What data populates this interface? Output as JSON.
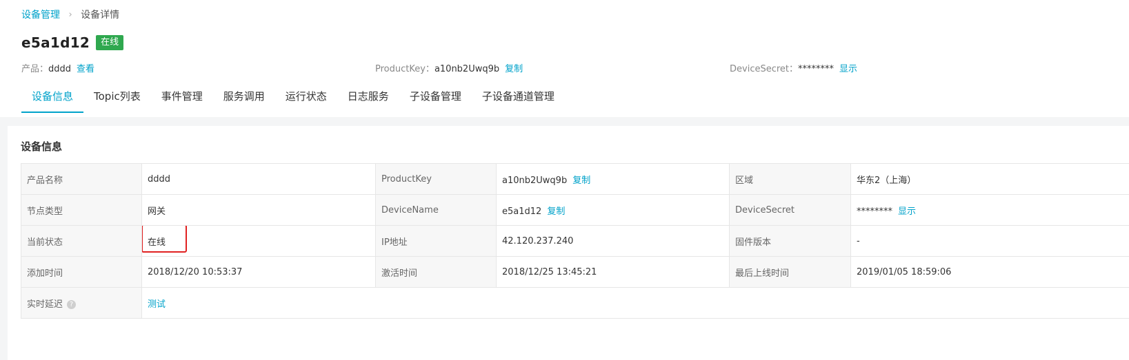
{
  "breadcrumb": {
    "parent": "设备管理",
    "separator": "›",
    "current": "设备详情"
  },
  "device": {
    "name": "e5a1d12",
    "status_badge": "在线"
  },
  "meta": {
    "product_label": "产品：",
    "product_value": "dddd",
    "product_action": "查看",
    "productkey_label": "ProductKey：",
    "productkey_value": "a10nb2Uwq9b",
    "productkey_action": "复制",
    "secret_label": "DeviceSecret：",
    "secret_value": "********",
    "secret_action": "显示"
  },
  "tabs": [
    "设备信息",
    "Topic列表",
    "事件管理",
    "服务调用",
    "运行状态",
    "日志服务",
    "子设备管理",
    "子设备通道管理"
  ],
  "panel": {
    "title": "设备信息",
    "rows": [
      {
        "k1": "产品名称",
        "v1": "dddd",
        "k2": "ProductKey",
        "v2": "a10nb2Uwq9b",
        "v2_action": "复制",
        "k3": "区域",
        "v3": "华东2（上海）"
      },
      {
        "k1": "节点类型",
        "v1": "网关",
        "k2": "DeviceName",
        "v2": "e5a1d12",
        "v2_action": "复制",
        "k3": "DeviceSecret",
        "v3": "********",
        "v3_action": "显示"
      },
      {
        "k1": "当前状态",
        "v1": "在线",
        "k2": "IP地址",
        "v2": "42.120.237.240",
        "k3": "固件版本",
        "v3": "-"
      },
      {
        "k1": "添加时间",
        "v1": "2018/12/20 10:53:37",
        "k2": "激活时间",
        "v2": "2018/12/25 13:45:21",
        "k3": "最后上线时间",
        "v3": "2019/01/05 18:59:06"
      },
      {
        "k1": "实时延迟",
        "k1_icon": "?",
        "v1": "测试"
      }
    ]
  },
  "colors": {
    "accent": "#00a2ca",
    "online": "#2fa84f",
    "highlight": "#e02020"
  },
  "icons": {
    "breadcrumb_separator": "chevron-right-icon",
    "delay_help": "question-circle-icon"
  }
}
